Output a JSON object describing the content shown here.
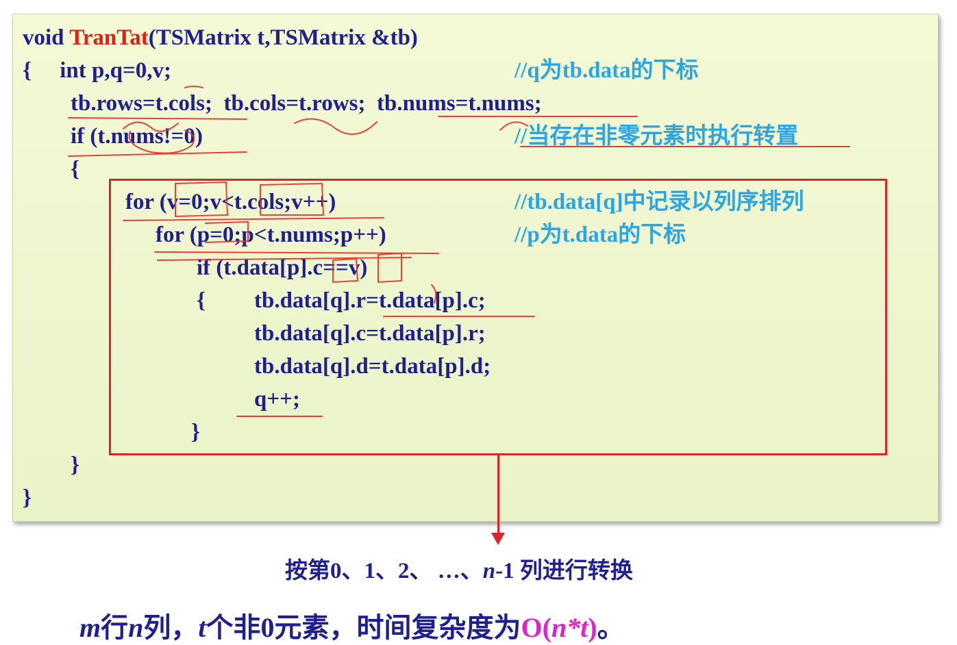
{
  "code": {
    "l1": {
      "kw": "void ",
      "fname": "TranTat",
      "rest": "(TSMatrix t,TSMatrix &tb)"
    },
    "l2": "{     int p,q=0,v;",
    "l2_comment": "//q为tb.data的下标",
    "l3": "tb.rows=t.cols;  tb.cols=t.rows;  tb.nums=t.nums;",
    "l4": "if (t.nums!=0)",
    "l4_comment": "//当存在非零元素时执行转置",
    "l5": "{",
    "l6": "for (v=0;v<t.cols;v++)",
    "l6_comment": "//tb.data[q]中记录以列序排列",
    "l7": "for (p=0;p<t.nums;p++)",
    "l7_comment": "//p为t.data的下标",
    "l8": "if (t.data[p].c==v)",
    "l9_brace": "{",
    "l9": "tb.data[q].r=t.data[p].c;",
    "l10": "tb.data[q].c=t.data[p].r;",
    "l11": "tb.data[q].d=t.data[p].d;",
    "l12": "q++;",
    "l13": "}",
    "l14": "}",
    "l15": "}"
  },
  "column_note": {
    "a": "按第0、1、2、 …、",
    "n": "n",
    "b": "-1 列进行转换"
  },
  "complexity_note": {
    "m": "m",
    "t1": "行",
    "n": "n",
    "t2": "列，",
    "t": "t",
    "t3": "个非0元素，时间复杂度为",
    "o_open": "O(",
    "o_expr": "n*t",
    "o_close": ")",
    "end": "。"
  },
  "colors": {
    "code_text": "#1f1f8f",
    "function_name": "#e02010",
    "comment": "#2aa5e6",
    "box_border": "#d9262a",
    "panel_bg": "#eff6cf",
    "complexity_highlight": "#e024c8",
    "handwriting": "#e8302a"
  }
}
